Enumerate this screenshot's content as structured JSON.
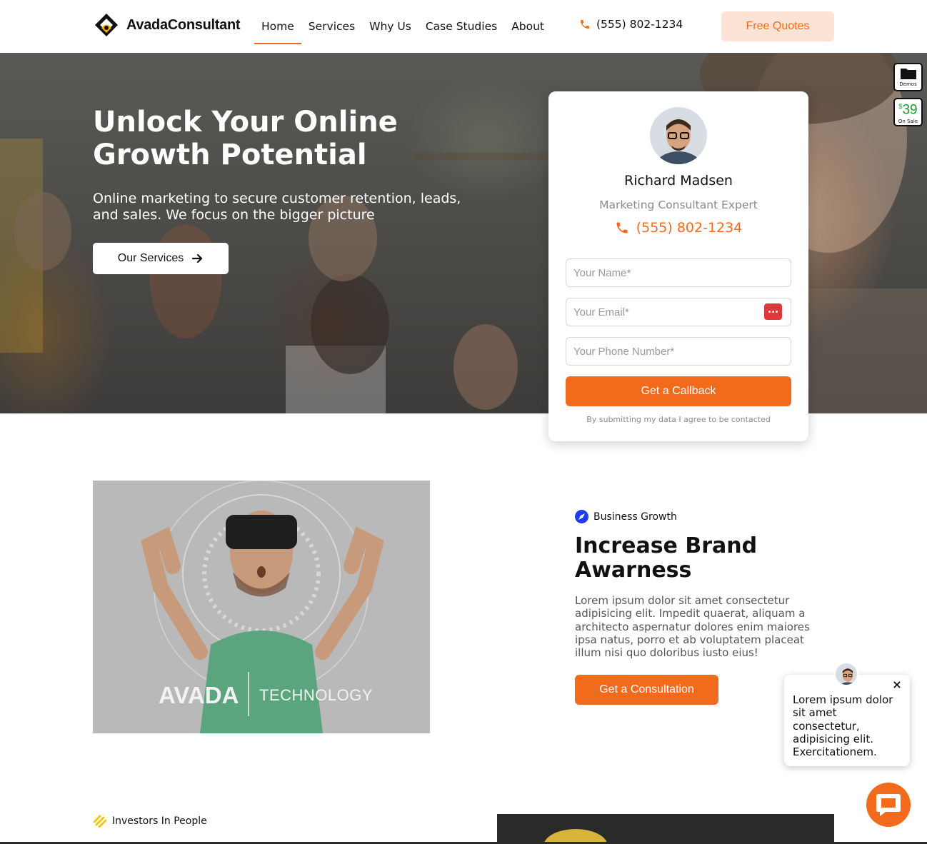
{
  "header": {
    "brand": "AvadaConsultant",
    "nav": [
      {
        "label": "Home",
        "active": true
      },
      {
        "label": "Services"
      },
      {
        "label": "Why Us"
      },
      {
        "label": "Case Studies"
      },
      {
        "label": "About"
      }
    ],
    "phone": "(555) 802-1234",
    "cta": "Free Quotes"
  },
  "hero": {
    "title": "Unlock Your Online Growth Potential",
    "subtitle": "Online marketing to secure customer retention, leads, and sales. We focus on the bigger picture",
    "button": "Our Services"
  },
  "side_badges": {
    "demos": "Demos",
    "price_currency": "$",
    "price": "39",
    "on_sale": "On Sale"
  },
  "contact_card": {
    "name": "Richard Madsen",
    "role": "Marketing Consultant Expert",
    "phone": "(555) 802-1234",
    "name_placeholder": "Your Name*",
    "email_placeholder": "Your Email*",
    "phone_placeholder": "Your Phone Number*",
    "button": "Get a Callback",
    "note": "By submitting my data I agree to be contacted"
  },
  "feature": {
    "image_text_left": "AVADA",
    "image_text_right": "TECHNOLOGY",
    "tag": "Business Growth",
    "title": "Increase Brand Awarness",
    "body": "Lorem ipsum dolor sit amet consectetur adipisicing elit. Impedit quaerat, aliquam a architecto aspernatur dolores enim maiores ipsa natus, porro et ab voluptatem placeat illum nisi quo doloribus iusto eius!",
    "button": "Get a Consultation"
  },
  "next_section": {
    "tag": "Investors In People"
  },
  "chat": {
    "message": "Lorem ipsum dolor sit amet consectetur, adipisicing elit. Exercitationem.",
    "close": "×"
  },
  "colors": {
    "accent": "#f26b1d",
    "accent_light": "#fde3d6",
    "tag_blue": "#1d3cf3",
    "sale_green": "#1a9a2d"
  }
}
